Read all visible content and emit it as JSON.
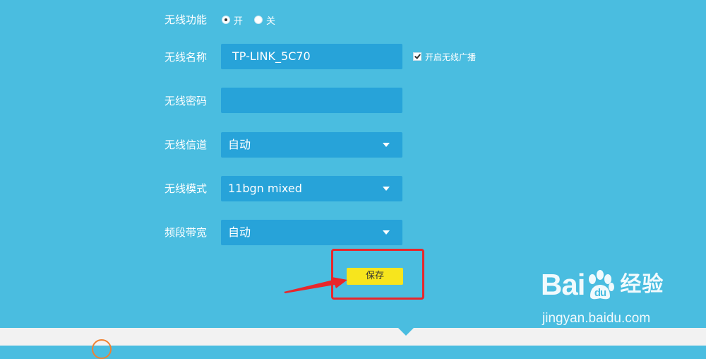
{
  "form": {
    "wireless_function": {
      "label": "无线功能",
      "options": [
        {
          "label": "开",
          "checked": true
        },
        {
          "label": "关",
          "checked": false
        }
      ]
    },
    "ssid": {
      "label": "无线名称",
      "value": "TP-LINK_5C70",
      "broadcast_label": "开启无线广播",
      "broadcast_checked": true
    },
    "password": {
      "label": "无线密码",
      "value": ""
    },
    "channel": {
      "label": "无线信道",
      "selected": "自动"
    },
    "mode": {
      "label": "无线模式",
      "selected": "11bgn mixed"
    },
    "bandwidth": {
      "label": "频段带宽",
      "selected": "自动"
    },
    "save_label": "保存"
  },
  "watermark": {
    "logo_left": "Bai",
    "logo_right": "u",
    "logo_cn": "经验",
    "url": "jingyan.baidu.com"
  },
  "colors": {
    "background": "#4ABDE0",
    "field": "#27A3D9",
    "save_button": "#F7E51D",
    "highlight": "#E8262B",
    "footer": "#F2F2F2"
  }
}
